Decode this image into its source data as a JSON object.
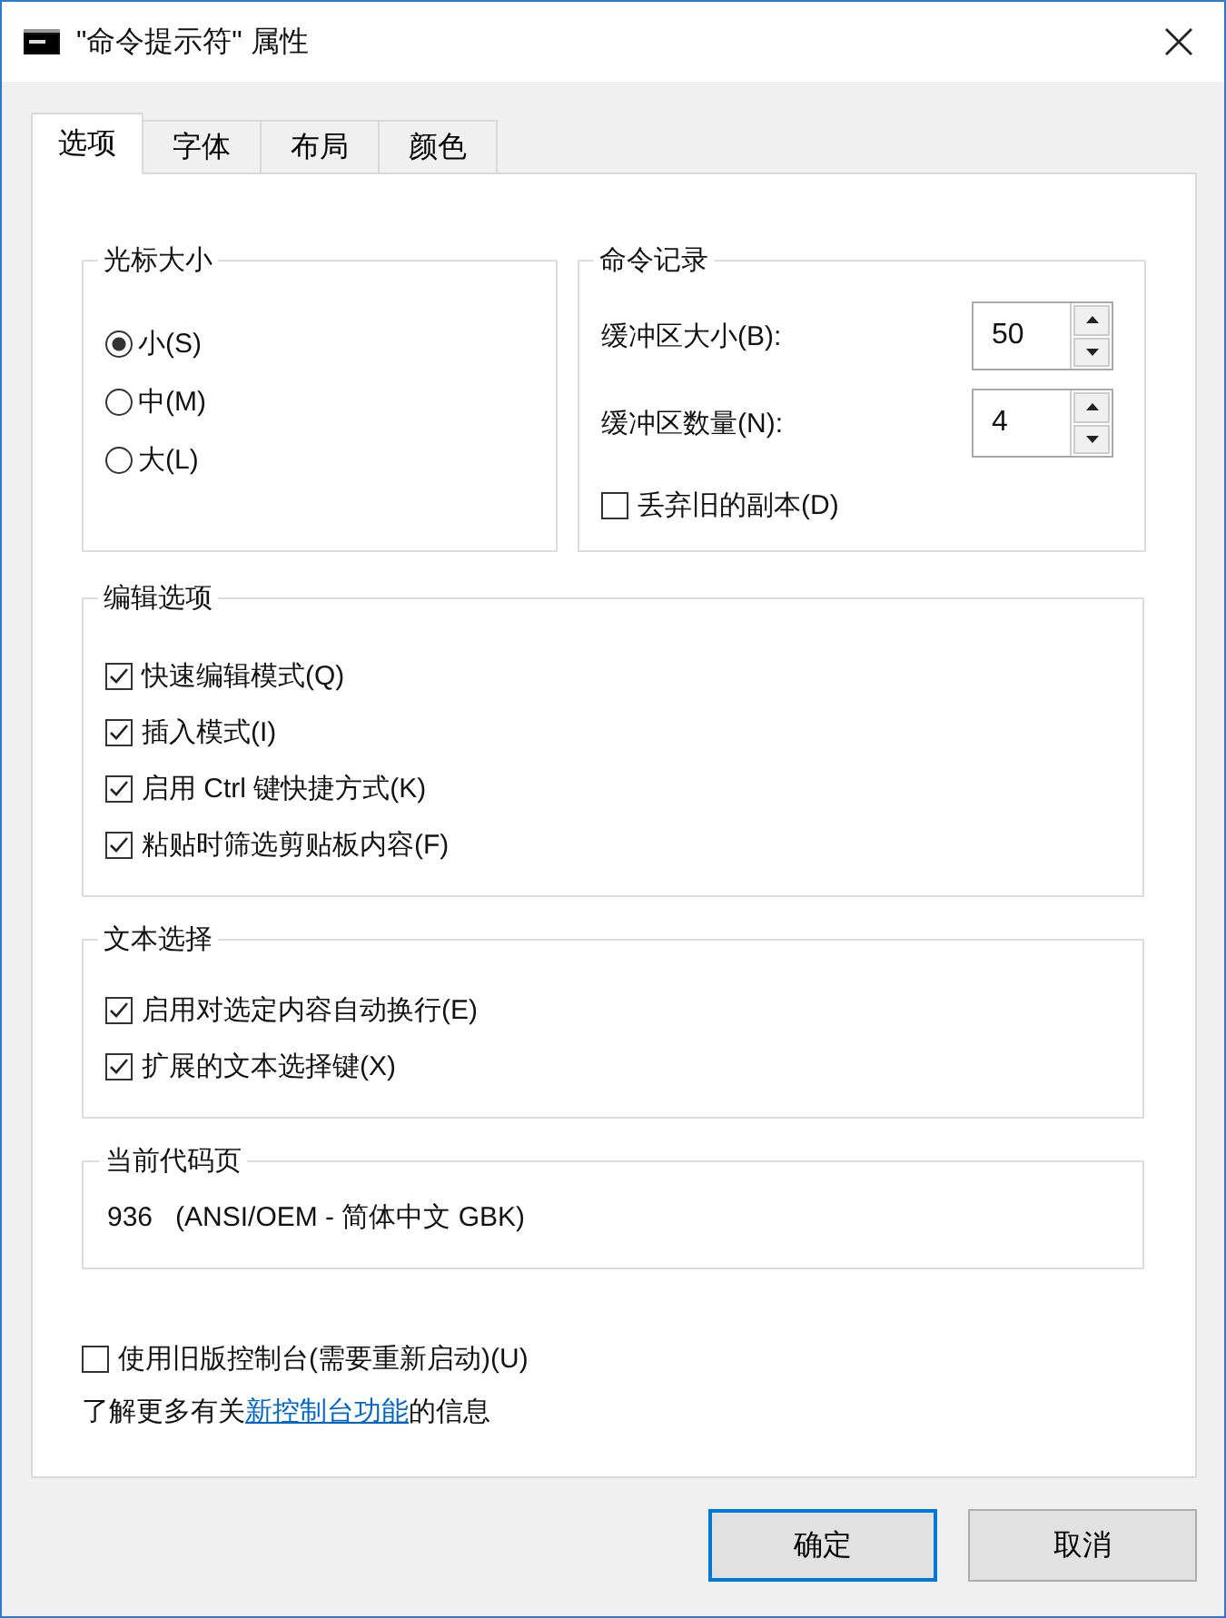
{
  "window": {
    "title": "\"命令提示符\" 属性"
  },
  "tabs": [
    {
      "label": "选项",
      "selected": true
    },
    {
      "label": "字体",
      "selected": false
    },
    {
      "label": "布局",
      "selected": false
    },
    {
      "label": "颜色",
      "selected": false
    }
  ],
  "cursor_size": {
    "title": "光标大小",
    "options": [
      {
        "label": "小(S)",
        "selected": true
      },
      {
        "label": "中(M)",
        "selected": false
      },
      {
        "label": "大(L)",
        "selected": false
      }
    ]
  },
  "command_history": {
    "title": "命令记录",
    "fields": [
      {
        "label": "缓冲区大小(B):",
        "value": "50"
      },
      {
        "label": "缓冲区数量(N):",
        "value": "4"
      }
    ],
    "discard_old": {
      "label": "丢弃旧的副本(D)",
      "checked": false
    }
  },
  "edit_options": {
    "title": "编辑选项",
    "items": [
      {
        "label": "快速编辑模式(Q)",
        "checked": true
      },
      {
        "label": "插入模式(I)",
        "checked": true
      },
      {
        "label": "启用 Ctrl 键快捷方式(K)",
        "checked": true
      },
      {
        "label": "粘贴时筛选剪贴板内容(F)",
        "checked": true
      }
    ]
  },
  "text_selection": {
    "title": "文本选择",
    "items": [
      {
        "label": "启用对选定内容自动换行(E)",
        "checked": true
      },
      {
        "label": "扩展的文本选择键(X)",
        "checked": true
      }
    ]
  },
  "code_page": {
    "title": "当前代码页",
    "value": "936   (ANSI/OEM - 简体中文 GBK)"
  },
  "legacy_console": {
    "label": "使用旧版控制台(需要重新启动)(U)",
    "checked": false
  },
  "info": {
    "before": "了解更多有关",
    "link": "新控制台功能",
    "after": "的信息"
  },
  "buttons": [
    {
      "label": "确定",
      "default": true
    },
    {
      "label": "取消",
      "default": false
    }
  ]
}
